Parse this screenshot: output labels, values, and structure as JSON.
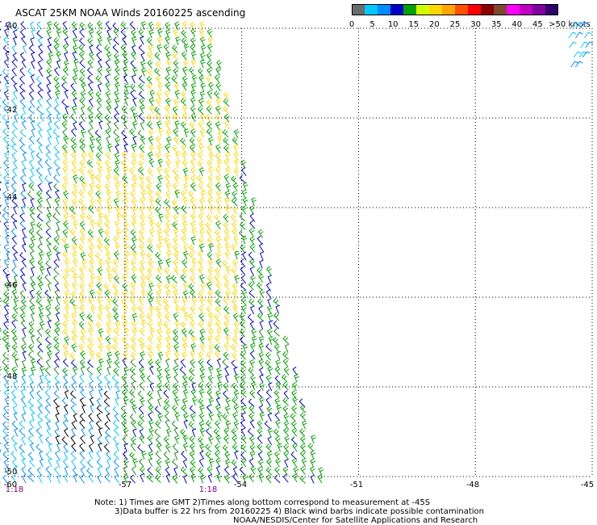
{
  "title": "ASCAT 25KM NOAA Winds 20160225 ascending",
  "colorbar": {
    "colors": [
      "#6b6b6b",
      "#00c8ff",
      "#008cff",
      "#0000c8",
      "#00a000",
      "#d2ff00",
      "#ffd700",
      "#ffa500",
      "#ff5000",
      "#ff0000",
      "#8b0000",
      "#7b4a30",
      "#ff00ff",
      "#c000c0",
      "#8000a0",
      "#300070"
    ],
    "labels": [
      "0",
      "5",
      "10",
      "15",
      "20",
      "25",
      "30",
      "35",
      "40",
      "45",
      ">50 knots"
    ]
  },
  "map": {
    "lat_labels": [
      "-40",
      "-42",
      "-44",
      "-46",
      "-48",
      "-50"
    ],
    "lon_labels": [
      "-60",
      "-57",
      "-54",
      "-51",
      "-48",
      "-45"
    ],
    "time_labels": [
      "1:18",
      "1:18"
    ],
    "lat_range": [
      -50,
      -40
    ],
    "lon_range": [
      -60,
      -45
    ],
    "grid": "dotted",
    "swath_west_lon": -60,
    "swath_east_lon_north": -54.6,
    "swath_east_lon_south": -52.2,
    "barb_color_by_speed": {
      "lt15": "blue/cyan",
      "15_25": "green",
      "gt25": "yellow",
      "contaminated": "black"
    }
  },
  "notes": {
    "line1": "Note: 1) Times are GMT 2)Times along bottom correspond to measurement at -45S",
    "line2": "3)Data buffer is 22 hrs from 20160225 4) Black wind barbs indicate possible contamination",
    "line3": "NOAA/NESDIS/Center for Satellite Applications and Research"
  }
}
